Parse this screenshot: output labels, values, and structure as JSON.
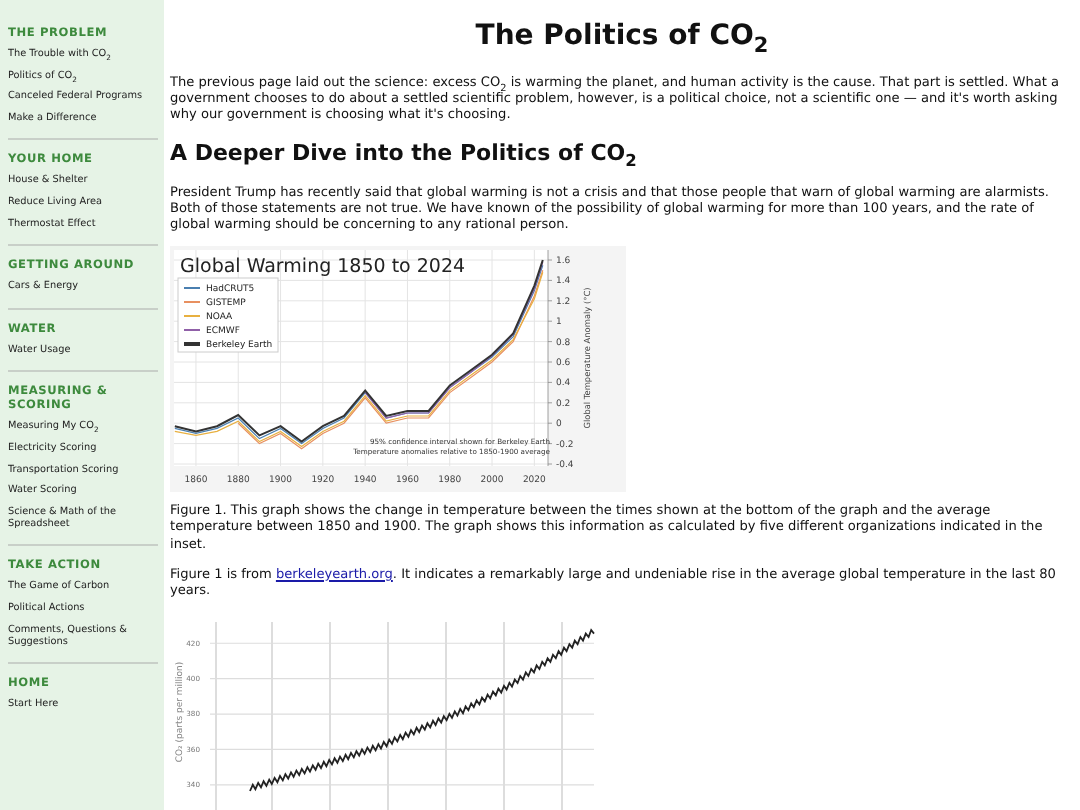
{
  "sidebar": {
    "sections": [
      {
        "heading": "THE PROBLEM",
        "items": [
          "The Trouble with CO$_{2}$",
          "Politics of CO$_{2}$",
          "Canceled Federal Programs",
          "Make a Difference"
        ]
      },
      {
        "heading": "YOUR HOME",
        "items": [
          "House & Shelter",
          "Reduce Living Area",
          "Thermostat Effect"
        ]
      },
      {
        "heading": "GETTING AROUND",
        "items": [
          "Cars & Energy"
        ]
      },
      {
        "heading": "WATER",
        "items": [
          "Water Usage"
        ]
      },
      {
        "heading": "MEASURING & SCORING",
        "items": [
          "Measuring My CO$_{2}$",
          "Electricity Scoring",
          "Transportation Scoring",
          "Water Scoring",
          "Science & Math of the Spreadsheet"
        ]
      },
      {
        "heading": "TAKE ACTION",
        "items": [
          "The Game of Carbon",
          "Political Actions",
          "Comments, Questions & Suggestions"
        ]
      },
      {
        "heading": "HOME",
        "items": [
          "Start Here"
        ]
      }
    ]
  },
  "main": {
    "title": "The Politics of CO$_{2}$",
    "intro": "The previous page laid out the science: excess CO$_{2}$ is warming the planet, and human activity is the cause. That part is settled. What a government chooses to do about a settled scientific problem, however, is a political choice, not a scientific one — and it's worth asking why our government is choosing what it's choosing.",
    "subtitle": "A Deeper Dive into the Politics of CO$_{2}$",
    "paragraph": "President Trump has recently said that global warming is not a crisis and that those people that warn of global warming are alarmists. Both of those statements are not true. We have known of the possibility of global warming for more than 100 years, and the rate of global warming should be concerning to any rational person.",
    "figure1": {
      "chart_data": {
        "type": "line",
        "title": "Global Warming 1850 to 2024",
        "ylabel": "Global Temperature Anomaly (°C)",
        "x": [
          1850,
          1860,
          1870,
          1880,
          1890,
          1900,
          1910,
          1920,
          1930,
          1940,
          1950,
          1960,
          1970,
          1980,
          1990,
          2000,
          2010,
          2020,
          2024
        ],
        "xticks": [
          1860,
          1880,
          1900,
          1920,
          1940,
          1960,
          1980,
          2000,
          2020
        ],
        "yticks": [
          -0.4,
          -0.2,
          0,
          0.2,
          0.4,
          0.6,
          0.8,
          1,
          1.2,
          1.4,
          1.6
        ],
        "xlim": [
          1850,
          2024
        ],
        "ylim": [
          -0.4,
          1.6
        ],
        "grid": true,
        "legend": true,
        "series": [
          {
            "name": "HadCRUT5",
            "color": "#4a7fb0",
            "values": [
              -0.05,
              -0.1,
              -0.05,
              0.05,
              -0.15,
              -0.05,
              -0.2,
              -0.05,
              0.05,
              0.3,
              0.05,
              0.1,
              0.1,
              0.35,
              0.5,
              0.65,
              0.85,
              1.3,
              1.55
            ]
          },
          {
            "name": "GISTEMP",
            "color": "#e89060",
            "values": [
              null,
              null,
              null,
              0.0,
              -0.2,
              -0.1,
              -0.25,
              -0.1,
              0.0,
              0.25,
              0.0,
              0.05,
              0.05,
              0.3,
              0.45,
              0.6,
              0.8,
              1.25,
              1.5
            ]
          },
          {
            "name": "NOAA",
            "color": "#e8b040",
            "values": [
              -0.08,
              -0.12,
              -0.08,
              0.02,
              -0.18,
              -0.08,
              -0.23,
              -0.08,
              0.02,
              0.27,
              0.02,
              0.07,
              0.07,
              0.32,
              0.47,
              0.62,
              0.82,
              1.22,
              1.48
            ]
          },
          {
            "name": "ECMWF",
            "color": "#9060a8",
            "values": [
              null,
              null,
              null,
              null,
              null,
              null,
              null,
              null,
              null,
              0.3,
              0.05,
              0.1,
              0.1,
              0.35,
              0.5,
              0.66,
              0.87,
              1.32,
              1.58
            ]
          },
          {
            "name": "Berkeley Earth",
            "color": "#333333",
            "values": [
              -0.03,
              -0.08,
              -0.03,
              0.08,
              -0.12,
              -0.03,
              -0.18,
              -0.03,
              0.07,
              0.32,
              0.07,
              0.12,
              0.12,
              0.37,
              0.52,
              0.67,
              0.88,
              1.35,
              1.6
            ]
          }
        ],
        "annotations": [
          "95% confidence interval shown for Berkeley Earth",
          "Temperature anomalies relative to 1850-1900 average"
        ]
      }
    },
    "caption": "Figure 1. This graph shows the change in temperature between the times shown at the bottom of the graph and the average temperature between 1850 and 1900. The graph shows this information as calculated by five different organizations indicated in the inset.",
    "source": {
      "before": "Figure 1 is from ",
      "link": "berkeleyearth.org",
      "after": ". It indicates a remarkably large and undeniable rise in the average global temperature in the last 80 years."
    },
    "figure2": {
      "chart_data": {
        "type": "line",
        "ylabel": "CO₂ (parts per million)",
        "yticks": [
          340,
          360,
          380,
          400,
          420
        ],
        "ylim": [
          319,
          432
        ],
        "grid": true,
        "series": [
          {
            "color": "#222222",
            "values": [
              338,
              341,
              344,
              347,
              350,
              353,
              356,
              359,
              362,
              366,
              370,
              374,
              378,
              382,
              387,
              392,
              397,
              403,
              409,
              415,
              421,
              427
            ]
          }
        ]
      }
    }
  }
}
